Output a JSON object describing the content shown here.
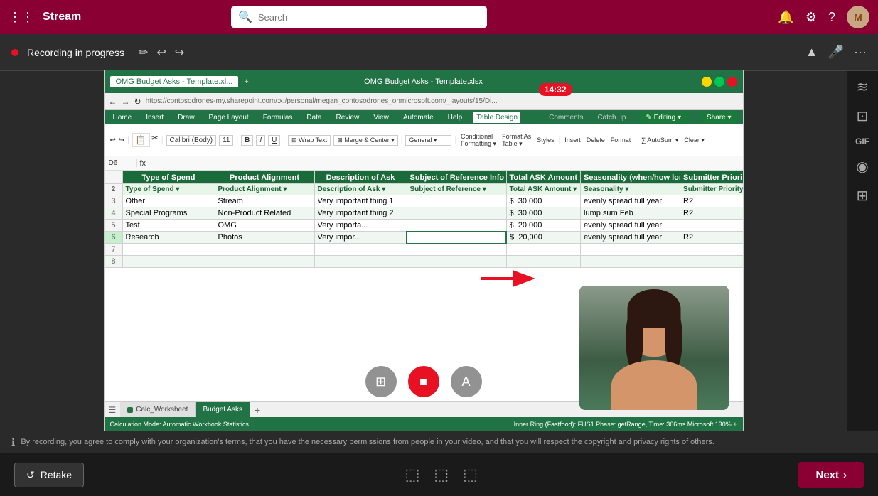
{
  "app": {
    "title": "Stream",
    "search_placeholder": "Search"
  },
  "recording": {
    "status": "Recording in progress",
    "timer": "14:32"
  },
  "excel": {
    "tab_name": "OMG Budget Asks - Template.xl...",
    "sheet_title": "OMG Budget Asks - Template.xlsx",
    "url": "https://contosodrones-my.sharepoint.com/:x:/personal/megan_contosodrones_onmicrosoft.com/_layouts/15/Di...",
    "active_tab": "Table Design",
    "formula_bar_ref": "D6",
    "table_headers": [
      "Type of Spend",
      "Product Alignment",
      "Description of Ask",
      "Subject of Reference Info (email or other...)",
      "Total ASK Amount",
      "Seasonality (when/how long)",
      "Submitter Priority"
    ],
    "rows": [
      {
        "num": "3",
        "type": "Other",
        "product": "Stream",
        "description": "Very important thing 1",
        "subject": "",
        "amount": "$ 30,000",
        "seasonality": "evenly spread full year",
        "priority": "R2"
      },
      {
        "num": "4",
        "type": "Special Programs",
        "product": "Non-Product Related",
        "description": "Very important thing 2",
        "subject": "",
        "amount": "$ 30,000",
        "seasonality": "lump sum Feb",
        "priority": "R2"
      },
      {
        "num": "5",
        "type": "Test",
        "product": "OMG",
        "description": "Very importa...",
        "subject": "",
        "amount": "$ 20,000",
        "seasonality": "evenly spread full year",
        "priority": ""
      },
      {
        "num": "6",
        "type": "Research",
        "product": "Photos",
        "description": "Very impor...",
        "subject": "",
        "amount": "$ 20,000",
        "seasonality": "evenly spread full year",
        "priority": "R2"
      }
    ],
    "sheet_tabs": [
      "Calc_Worksheet",
      "Budget Asks"
    ],
    "status_left": "Calculation Mode: Automatic    Workbook Statistics",
    "status_right": "Inner Ring (Fastfood): FUS1    Phase: getRange, Time: 366ms    Microsoft    130% +"
  },
  "controls": {
    "blur_label": "⊞",
    "stop_label": "■",
    "text_label": "A"
  },
  "footer": {
    "retake_label": "Retake",
    "next_label": "Next"
  },
  "consent": {
    "text": "By recording, you agree to comply with your organization's terms, that you have the necessary permissions from people in your video, and that you will respect the copyright and privacy rights of others."
  },
  "sidebar_icons": {
    "icon1": "≋",
    "icon2": "☷",
    "icon3": "GIF",
    "icon4": "◉",
    "icon5": "⊞"
  }
}
